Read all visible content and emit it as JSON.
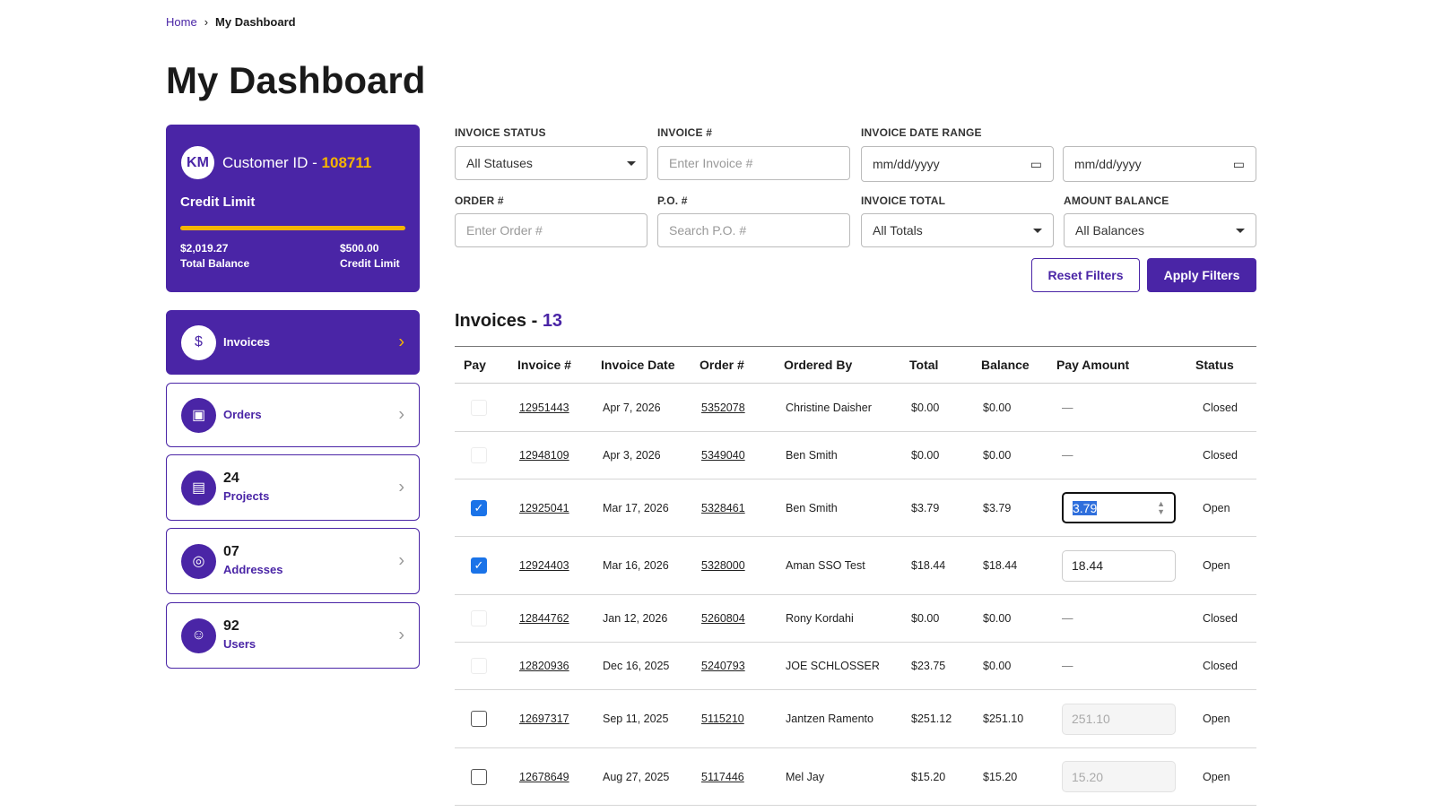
{
  "breadcrumb": {
    "home": "Home",
    "current": "My Dashboard"
  },
  "page_title": "My Dashboard",
  "customer": {
    "initials": "KM",
    "id_label": "Customer ID - ",
    "id": "108711",
    "credit_title": "Credit Limit",
    "credit_used_fraction": 1.0,
    "total_balance": "$2,019.27",
    "total_balance_label": "Total Balance",
    "credit_limit": "$500.00",
    "credit_limit_label": "Credit Limit"
  },
  "nav": [
    {
      "label": "Invoices",
      "count": null
    },
    {
      "label": "Orders",
      "count": null
    },
    {
      "label": "Projects",
      "count": "24"
    },
    {
      "label": "Addresses",
      "count": "07"
    },
    {
      "label": "Users",
      "count": "92"
    }
  ],
  "filters": {
    "invoice_status": {
      "label": "INVOICE STATUS",
      "value": "All Statuses"
    },
    "invoice_no": {
      "label": "INVOICE #",
      "placeholder": "Enter Invoice #"
    },
    "date_range": {
      "label": "INVOICE DATE RANGE",
      "from": "mm/dd/yyyy",
      "to": "mm/dd/yyyy"
    },
    "order_no": {
      "label": "ORDER #",
      "placeholder": "Enter Order #"
    },
    "po_no": {
      "label": "P.O. #",
      "placeholder": "Search P.O. #"
    },
    "invoice_total": {
      "label": "INVOICE TOTAL",
      "value": "All Totals"
    },
    "amount_balance": {
      "label": "AMOUNT BALANCE",
      "value": "All Balances"
    },
    "reset": "Reset Filters",
    "apply": "Apply Filters"
  },
  "invoices": {
    "title": "Invoices - ",
    "count": "13",
    "columns": [
      "Pay",
      "Invoice #",
      "Invoice Date",
      "Order #",
      "Ordered By",
      "Total",
      "Balance",
      "Pay Amount",
      "Status"
    ],
    "rows": [
      {
        "pay": "disabled",
        "invoice": "12951443",
        "date": "Apr 7, 2026",
        "order": "5352078",
        "by": "Christine Daisher",
        "total": "$0.00",
        "balance": "$0.00",
        "amount": "—",
        "status": "Closed"
      },
      {
        "pay": "disabled",
        "invoice": "12948109",
        "date": "Apr 3, 2026",
        "order": "5349040",
        "by": "Ben Smith",
        "total": "$0.00",
        "balance": "$0.00",
        "amount": "—",
        "status": "Closed"
      },
      {
        "pay": "checked",
        "invoice": "12925041",
        "date": "Mar 17, 2026",
        "order": "5328461",
        "by": "Ben Smith",
        "total": "$3.79",
        "balance": "$3.79",
        "amount": "3.79",
        "status": "Open",
        "focus": true
      },
      {
        "pay": "checked",
        "invoice": "12924403",
        "date": "Mar 16, 2026",
        "order": "5328000",
        "by": "Aman SSO Test",
        "total": "$18.44",
        "balance": "$18.44",
        "amount": "18.44",
        "status": "Open"
      },
      {
        "pay": "disabled",
        "invoice": "12844762",
        "date": "Jan 12, 2026",
        "order": "5260804",
        "by": "Rony Kordahi",
        "total": "$0.00",
        "balance": "$0.00",
        "amount": "—",
        "status": "Closed"
      },
      {
        "pay": "disabled",
        "invoice": "12820936",
        "date": "Dec 16, 2025",
        "order": "5240793",
        "by": "JOE SCHLOSSER",
        "total": "$23.75",
        "balance": "$0.00",
        "amount": "—",
        "status": "Closed"
      },
      {
        "pay": "unchecked",
        "invoice": "12697317",
        "date": "Sep 11, 2025",
        "order": "5115210",
        "by": "Jantzen Ramento",
        "total": "$251.12",
        "balance": "$251.10",
        "amount": "251.10",
        "status": "Open"
      },
      {
        "pay": "unchecked",
        "invoice": "12678649",
        "date": "Aug 27, 2025",
        "order": "5117446",
        "by": "Mel Jay",
        "total": "$15.20",
        "balance": "$15.20",
        "amount": "15.20",
        "status": "Open"
      }
    ]
  }
}
